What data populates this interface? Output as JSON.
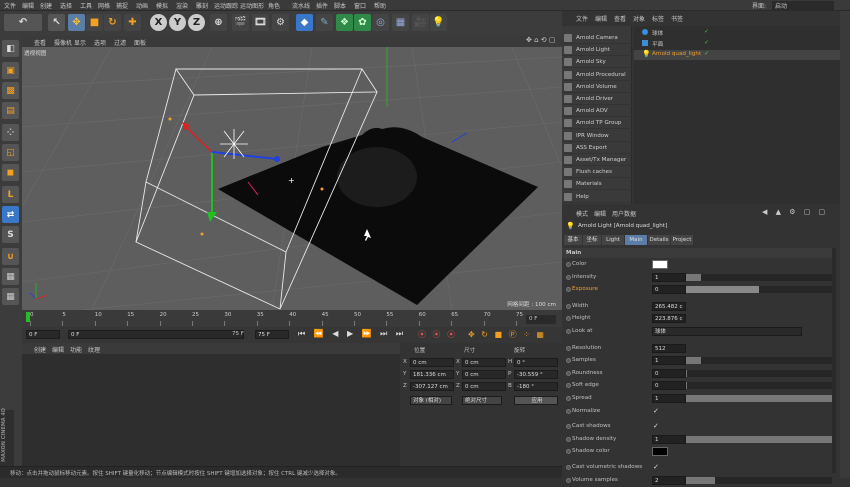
{
  "menu": {
    "items": [
      "文件",
      "编辑",
      "创建",
      "选择",
      "工具",
      "网格",
      "捕捉",
      "动画",
      "模拟",
      "渲染",
      "雕刻",
      "运动跟踪",
      "运动图形",
      "角色",
      "流水线",
      "插件",
      "脚本",
      "窗口",
      "帮助"
    ],
    "layout_label": "界面:",
    "layout_value": "启动"
  },
  "viewport": {
    "menu": [
      "查看",
      "摄像机",
      "显示",
      "选项",
      "过滤",
      "面板"
    ],
    "camera_label": "透视视图",
    "grid_info": "网格间距 : 100 cm"
  },
  "timeline": {
    "ticks": [
      "0",
      "5",
      "10",
      "15",
      "20",
      "25",
      "30",
      "35",
      "40",
      "45",
      "50",
      "55",
      "60",
      "65",
      "70",
      "75"
    ],
    "frame_end_marker": "0 F",
    "current_frame": "0 F",
    "start_frame": "0 F",
    "end_frame": "75 F",
    "max_frame": "75 F"
  },
  "material_panel": {
    "menu": [
      "创建",
      "编辑",
      "功能",
      "纹理"
    ]
  },
  "coords": {
    "headers": {
      "position": "位置",
      "size": "尺寸",
      "rotation": "旋转"
    },
    "x": {
      "label": "X",
      "pos": "0 cm",
      "size_label": "X",
      "size": "0 cm",
      "rot_label": "H",
      "rot": "0 °"
    },
    "y": {
      "label": "Y",
      "pos": "181.336 cm",
      "size_label": "Y",
      "size": "0 cm",
      "rot_label": "P",
      "rot": "-30.559 °"
    },
    "z": {
      "label": "Z",
      "pos": "-307.127 cm",
      "size_label": "Z",
      "size": "0 cm",
      "rot_label": "B",
      "rot": "-180 °"
    },
    "mode": "对象 (相对)",
    "size_mode": "绝对尺寸",
    "apply": "应用"
  },
  "status": "移动：点击并拖动鼠标移动元素。按住 SHIFT 键量化移动；节点编辑模式时按住 SHIFT 键增加选择对象；按住 CTRL 键减少选择对象。",
  "arnold_menu": [
    "Arnold Camera",
    "Arnold Light",
    "Arnold Sky",
    "Arnold Procedural",
    "Arnold Volume",
    "Arnold Driver",
    "Arnold AOV",
    "Arnold TP Group",
    "IPR Window",
    "ASS Export",
    "Asset/Tx Manager",
    "Flush caches",
    "Materials",
    "Help"
  ],
  "object_manager": {
    "menu": [
      "文件",
      "编辑",
      "查看",
      "对象",
      "标签",
      "书签"
    ],
    "objects": [
      "球体",
      "平面",
      "Arnold quad_light"
    ]
  },
  "attr_manager": {
    "menu": [
      "模式",
      "编辑",
      "用户数据"
    ],
    "title": "Arnold Light [Arnold quad_light]",
    "tabs": [
      "基本",
      "坐标",
      "Light",
      "Main",
      "Details",
      "Project"
    ],
    "active_tab": "Main",
    "section": "Main",
    "rows": [
      {
        "label": "Color",
        "type": "color",
        "value": ""
      },
      {
        "label": "Intensity",
        "type": "slider",
        "value": "1",
        "fill": 0.1
      },
      {
        "label": "Exposure",
        "type": "slider",
        "value": "0",
        "fill": 0.5,
        "highlight": true
      },
      {
        "label": "Width",
        "type": "number",
        "value": "265.482 c"
      },
      {
        "label": "Height",
        "type": "number",
        "value": "223.876 c"
      },
      {
        "label": "Look at",
        "type": "link",
        "value": "球体"
      },
      {
        "label": "Resolution",
        "type": "number",
        "value": "512"
      },
      {
        "label": "Samples",
        "type": "slider",
        "value": "1",
        "fill": 0.1
      },
      {
        "label": "Roundness",
        "type": "slider",
        "value": "0",
        "fill": 0.01
      },
      {
        "label": "Soft edge",
        "type": "slider",
        "value": "0",
        "fill": 0.01
      },
      {
        "label": "Spread",
        "type": "slider",
        "value": "1",
        "fill": 1.0
      },
      {
        "label": "Normalize",
        "type": "check",
        "value": "✓"
      },
      {
        "label": "Cast shadows",
        "type": "check",
        "value": "✓"
      },
      {
        "label": "Shadow density",
        "type": "slider",
        "value": "1",
        "fill": 1.0
      },
      {
        "label": "Shadow color",
        "type": "color",
        "value": ""
      },
      {
        "label": "Cast volumetric shadows",
        "type": "check",
        "value": "✓"
      },
      {
        "label": "Volume samples",
        "type": "slider",
        "value": "2",
        "fill": 0.2
      }
    ]
  },
  "colors": {
    "accent": "#e8a33d",
    "selected_text": "#f0a030",
    "active_tab": "#5a7ea8"
  }
}
